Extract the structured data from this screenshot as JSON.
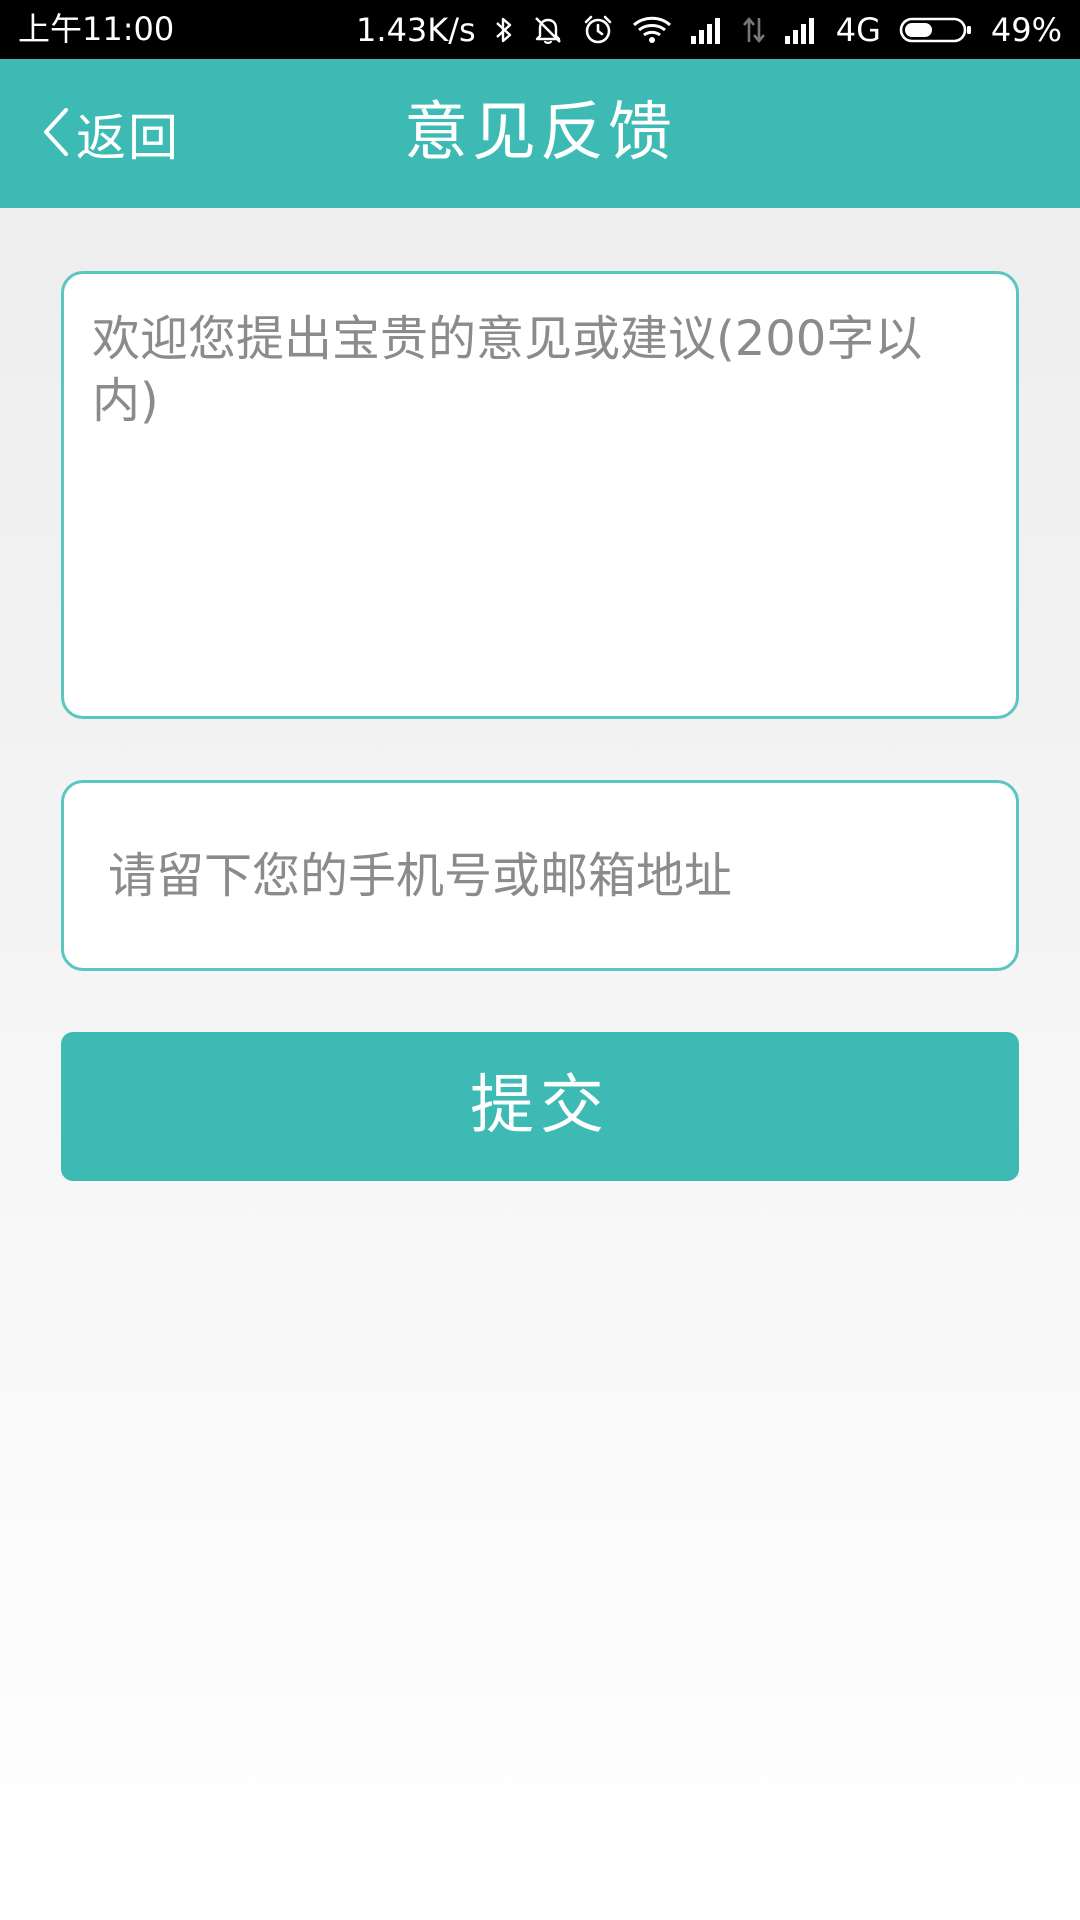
{
  "status_bar": {
    "time": "上午11:00",
    "network_speed": "1.43K/s",
    "network_type": "4G",
    "battery_percent": "49%",
    "battery_level": 0.49,
    "icons": [
      "bluetooth-icon",
      "mute-icon",
      "alarm-icon",
      "wifi-icon",
      "signal-icon",
      "data-transfer-icon",
      "signal-icon",
      "battery-icon"
    ]
  },
  "header": {
    "back_label": "返回",
    "title": "意见反馈",
    "background_color": "#3dbab4"
  },
  "form": {
    "feedback_placeholder": "欢迎您提出宝贵的意见或建议(200字以内)",
    "feedback_value": "",
    "contact_placeholder": "请留下您的手机号或邮箱地址",
    "contact_value": "",
    "submit_label": "提交",
    "border_color": "#5ac6c0"
  }
}
